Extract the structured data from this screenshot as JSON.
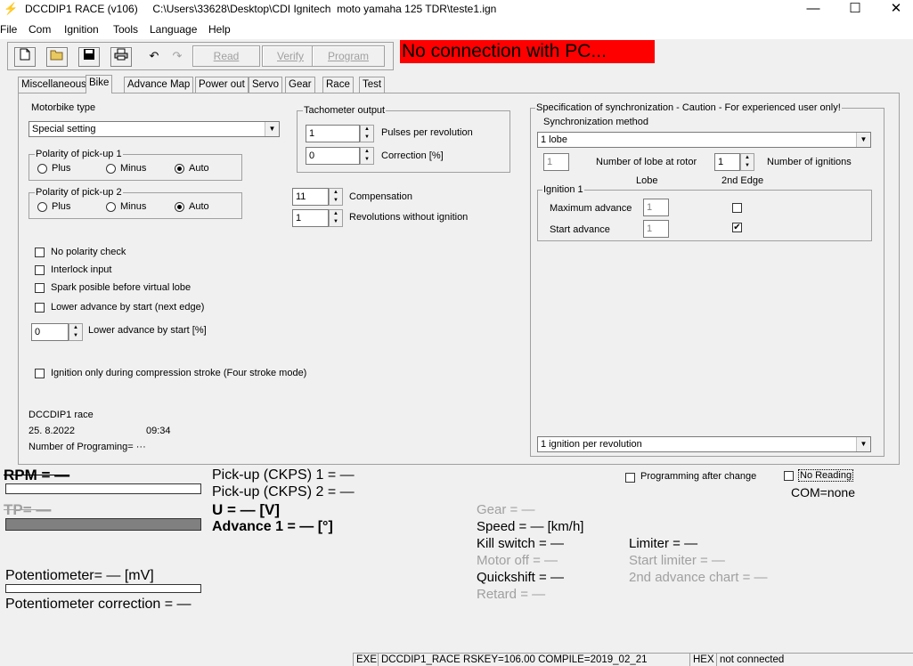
{
  "window": {
    "app_title": "DCCDIP1 RACE (v106)",
    "file_path": "C:\\Users\\33628\\Desktop\\CDI Ignitech  moto yamaha 125 TDR\\teste1.ign",
    "minimize": "—",
    "maximize": "☐",
    "close": "✕"
  },
  "menu": [
    "File",
    "Com",
    "Ignition",
    "Tools",
    "Language",
    "Help"
  ],
  "toolbar": {
    "icons": [
      "new-file-icon",
      "open-folder-icon",
      "save-icon",
      "print-icon",
      "undo-icon",
      "redo-icon"
    ],
    "read": "Read",
    "verify": "Verify",
    "program": "Program"
  },
  "connection_status": "No connection with PC...",
  "tabs": [
    "Miscellaneous",
    "Bike",
    "Advance Map",
    "Power out",
    "Servo",
    "Gear",
    "Race",
    "Test"
  ],
  "active_tab": "Bike",
  "bike": {
    "motorbike_type_label": "Motorbike type",
    "motorbike_type_value": "Special setting",
    "polarity1": {
      "label": "Polarity of pick-up 1",
      "plus": "Plus",
      "minus": "Minus",
      "auto": "Auto",
      "selected": "Auto"
    },
    "polarity2": {
      "label": "Polarity of pick-up 2",
      "plus": "Plus",
      "minus": "Minus",
      "auto": "Auto",
      "selected": "Auto"
    },
    "checks": {
      "no_polarity": "No polarity check",
      "interlock": "Interlock input",
      "spark_virtual": "Spark posible before virtual lobe",
      "lower_adv_next": "Lower advance by start (next edge)",
      "ignition_compression": "Ignition only during compression stroke (Four stroke mode)"
    },
    "lower_adv_pct_value": "0",
    "lower_adv_pct_label": "Lower advance by start [%]",
    "tacho": {
      "label": "Tachometer output",
      "pulses_value": "1",
      "pulses_label": "Pulses per revolution",
      "correction_value": "0",
      "correction_label": "Correction [%]"
    },
    "compensation_value": "11",
    "compensation_label": "Compensation",
    "rev_without_value": "1",
    "rev_without_label": "Revolutions without ignition",
    "info": {
      "name": "DCCDIP1 race",
      "date": "25. 8.2022",
      "time": "09:34",
      "programming": "Number of Programing= ···"
    },
    "sync": {
      "label": "Specification of synchronization - Caution - For experienced user only!",
      "method_label": "Synchronization method",
      "method_value": "1 lobe",
      "lobes_value": "1",
      "lobes_label": "Number of lobe at rotor",
      "ignitions_value": "1",
      "ignitions_label": "Number of ignitions",
      "col_lobe": "Lobe",
      "col_2nd_edge": "2nd Edge",
      "ignition1_label": "Ignition 1",
      "max_adv_label": "Maximum advance",
      "max_adv_value": "1",
      "start_adv_label": "Start advance",
      "start_adv_value": "1",
      "start_adv_checkmark": "✔",
      "per_rev_value": "1 ignition per revolution"
    }
  },
  "live": {
    "rpm": "RPM = —",
    "tp": "TP= —",
    "pickup1": "Pick-up (CKPS) 1 = —",
    "pickup2": "Pick-up (CKPS) 2 = —",
    "voltage": "U = — [V]",
    "advance1": "Advance 1 = — [°]",
    "potentiometer": "Potentiometer= — [mV]",
    "pot_correction": "Potentiometer correction = —",
    "gear": "Gear = —",
    "speed": "Speed = — [km/h]",
    "kill_switch": "Kill switch = —",
    "motor_off": "Motor off = —",
    "quickshift": "Quickshift = —",
    "retard": "Retard = —",
    "limiter": "Limiter = —",
    "start_limiter": "Start limiter = —",
    "second_advance": "2nd advance chart = —",
    "programming_after_change": "Programming after change",
    "no_reading": "No Reading",
    "com": "COM=none"
  },
  "statusbar": {
    "exe": "EXE",
    "info": "DCCDIP1_RACE   RSKEY=106.00   COMPILE=2019_02_21",
    "hex": "HEX",
    "connection": "not connected"
  }
}
